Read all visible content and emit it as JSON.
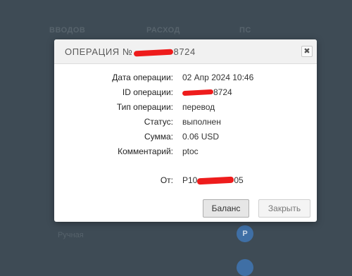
{
  "background": {
    "columns": [
      "ВВОДОВ",
      "РАСХОД",
      "ПС"
    ],
    "row_text": "Ручная",
    "badge": "P"
  },
  "modal": {
    "title_prefix": "ОПЕРАЦИЯ №",
    "title_suffix": "8724",
    "close_symbol": "✖",
    "fields": {
      "date_label": "Дата операции:",
      "date_value": "02 Апр 2024 10:46",
      "id_label": "ID операции:",
      "id_suffix": "8724",
      "type_label": "Тип операции:",
      "type_value": "перевод",
      "status_label": "Статус:",
      "status_value": "выполнен",
      "amount_label": "Сумма:",
      "amount_value": "0.06 USD",
      "comment_label": "Комментарий:",
      "comment_value": "ptoc",
      "from_label": "От:",
      "from_prefix": "P10",
      "from_suffix": "05"
    },
    "buttons": {
      "balance": "Баланс",
      "close": "Закрыть"
    }
  },
  "colors": {
    "backdrop": "#3e4b55",
    "redaction": "#ee1c1c"
  }
}
